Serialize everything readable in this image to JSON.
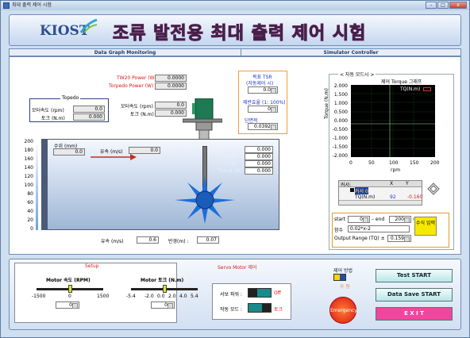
{
  "window": {
    "title": "최대 출력 제어 시험",
    "min": "–",
    "max": "□",
    "close": "x"
  },
  "header": {
    "logo": "KIOST",
    "title": "조류 발전용 최대 출력 제어 시험"
  },
  "tabs": {
    "left": "Data Graph Monitoring",
    "right": "Simulator Controller"
  },
  "power": {
    "tw20_label": "TW20 Power (W)",
    "tw20_value": "0.0000",
    "torpedo_label": "Torpedo Power (W)",
    "torpedo_value": "0.0000"
  },
  "topedo": {
    "title": "Topedo",
    "speed_label": "모터속도 (rpm)",
    "speed_value": "0.0",
    "torque_label": "토크 (N.m)",
    "torque_value": "0.000"
  },
  "motor": {
    "speed_label": "모터속도 (rpm)",
    "speed_value": "0.0",
    "torque_label": "토크 (N.m)",
    "torque_value": "0.000"
  },
  "tank": {
    "depth_label": "수위 (mm)",
    "depth_value": "0.0",
    "flow_label": "유속 (m/s)",
    "flow_value": "0.0",
    "x_label": "X (N)",
    "x_value": "0.000",
    "y_label": "Y (N)",
    "y_value": "0.000",
    "z_label": "Z (N)",
    "z_value": "0.000",
    "thrust_label": "Thrust (N)",
    "thrust_value": "0.000",
    "axis": [
      "200",
      "180",
      "160",
      "140",
      "120",
      "100",
      "80",
      "60",
      "40",
      "20",
      "0"
    ]
  },
  "bottomrow": {
    "flow_label": "유속 (m/s)",
    "flow_value": "0.6",
    "radius_label": "반경(m) :",
    "radius_value": "0.07"
  },
  "tsr": {
    "title": "목표 TSR",
    "subtitle": "(자동제어 시)",
    "value": "0.0",
    "eff_label": "제반효율 (1: 100%)",
    "eff_value": "0",
    "area_label": "단면적",
    "area_value": "0.0392"
  },
  "auto": {
    "title": "< 자동 모드시 >",
    "graph_title": "제어 Torque 그래프",
    "legend": "TQ(N.m)",
    "ylabel": "Torque (N.m)",
    "xlabel": "rpm",
    "yticks": [
      "2.000",
      "1.500",
      "1.000",
      "0.500",
      "0.000",
      "-0.500",
      "-1.000",
      "-1.500",
      "-2.000"
    ],
    "xticks": [
      "0",
      "50",
      "100",
      "150",
      "200"
    ]
  },
  "cursor": {
    "header": "커서:",
    "col_x": "X",
    "col_y": "Y",
    "name1": "커서 0",
    "name2": "TQ(N.m)",
    "x_value": "92",
    "y_value": "-0.160"
  },
  "formula": {
    "start_label": "start",
    "start_value": "0",
    "end_label": "– end",
    "end_value": "200",
    "rpm_label": "rpm",
    "func_label": "함수",
    "func_value": "0.02*x-2",
    "range_label": "Output Range (TQ)  ±",
    "range_value": "0.159",
    "input_button": "수식 입력"
  },
  "bottom": {
    "setup_label": "Setup",
    "servo_label": "Servo Motor 제어",
    "speed_title": "Motor 속도 (RPM)",
    "speed_ticks": [
      "-1500",
      "0",
      "1500"
    ],
    "speed_value": "0",
    "torque_title": "Motor 토크 (N.m)",
    "torque_ticks": [
      "-5.4",
      "-2.0",
      "0.0",
      "2.0",
      "4.0",
      "5.4"
    ],
    "torque_value": "0",
    "servo_power_label": "서보 파워 :",
    "servo_power_state": "Off",
    "drive_mode_label": "작동 모드 :",
    "drive_mode_state": "토크",
    "control_method_label": "제어 방법",
    "control_state": "수 동",
    "emergency": "Emergency",
    "test_start": "Test  START",
    "data_save_start": "Data Save START",
    "exit": "E X I T"
  },
  "colors": {
    "accent": "#e0389a",
    "brand": "#2c4f8f",
    "emergency": "#ff3d00",
    "exit_bg": "#f0469e",
    "servo_red": "#d9181c"
  }
}
